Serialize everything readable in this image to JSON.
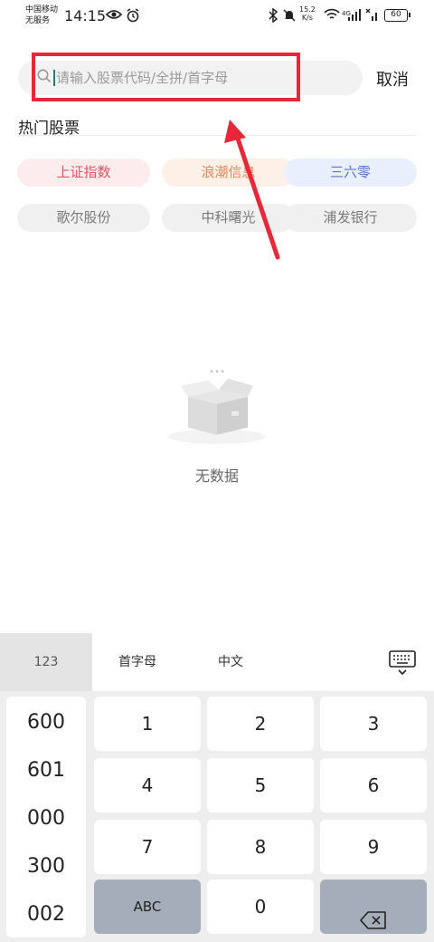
{
  "status_bar": {
    "carrier_line1": "中国移动",
    "carrier_line2": "无服务",
    "time": "14:15",
    "speed_value": "15.2",
    "speed_unit": "K/s",
    "network_type": "4G",
    "battery": "60"
  },
  "search": {
    "placeholder": "请输入股票代码/全拼/首字母",
    "value": "",
    "cancel_label": "取消"
  },
  "hot_stocks": {
    "title": "热门股票",
    "items": [
      {
        "label": "上证指数",
        "color": "#e35461"
      },
      {
        "label": "浪潮信息",
        "color": "#e0895a"
      },
      {
        "label": "三六零",
        "color": "#5b74c9"
      },
      {
        "label": "歌尔股份",
        "color": "#7a7a7a"
      },
      {
        "label": "中科曙光",
        "color": "#7a7a7a"
      },
      {
        "label": "浦发银行",
        "color": "#7a7a7a"
      }
    ]
  },
  "empty_state": {
    "text": "无数据"
  },
  "keyboard": {
    "modes": [
      "123",
      "首字母",
      "中文"
    ],
    "side_codes": [
      "600",
      "601",
      "000",
      "300",
      "002"
    ],
    "keys": [
      "1",
      "2",
      "3",
      "4",
      "5",
      "6",
      "7",
      "8",
      "9",
      "ABC",
      "0"
    ]
  },
  "annotation": {
    "color": "#e8283a"
  }
}
